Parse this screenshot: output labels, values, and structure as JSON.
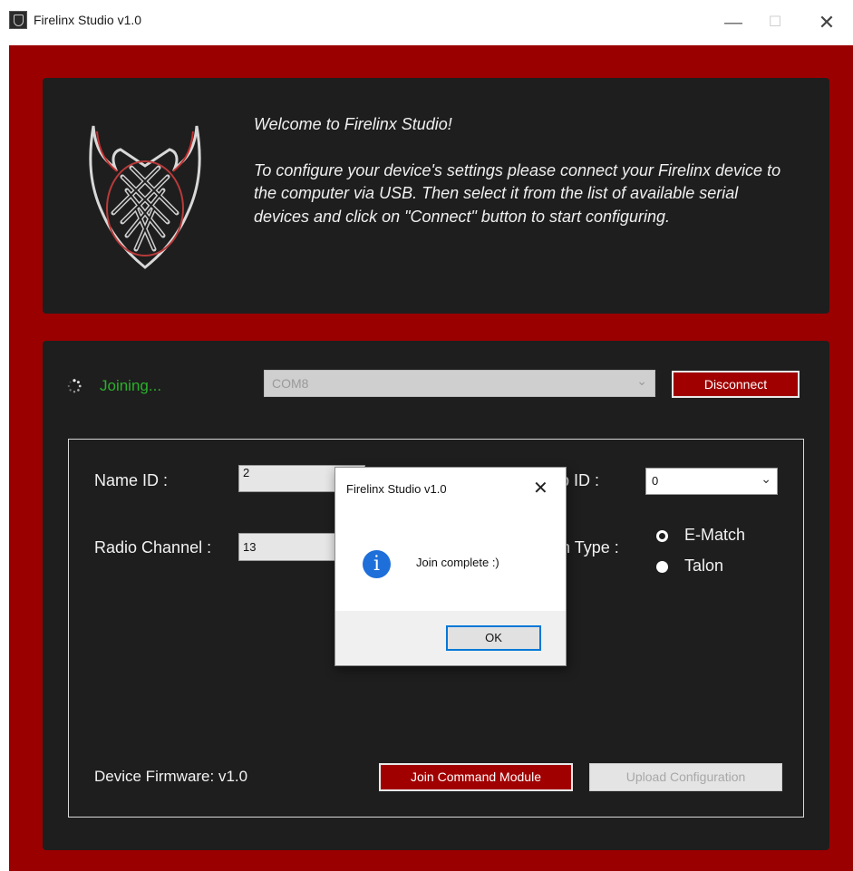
{
  "window": {
    "title": "Firelinx Studio  v1.0",
    "minimize_glyph": "—",
    "maximize_glyph": "☐",
    "close_glyph": "✕"
  },
  "welcome": {
    "heading": "Welcome to Firelinx Studio!",
    "body": "To configure your device's settings please connect your Firelinx device to the computer via USB. Then select it from the list of available serial devices and click on \"Connect\" button to start configuring."
  },
  "connection": {
    "status_text": "Joining...",
    "port_value": "COM8",
    "disconnect_label": "Disconnect"
  },
  "config": {
    "name_id_label": "Name ID :",
    "name_id_value": "2",
    "radio_channel_label": "Radio Channel :",
    "radio_channel_value": "13",
    "group_id_label": "Group ID :",
    "group_id_value": "0",
    "match_type_label": "Match Type :",
    "match_options": [
      {
        "label": "E-Match",
        "selected": false
      },
      {
        "label": "Talon",
        "selected": true
      }
    ],
    "firmware_text": "Device Firmware: v1.0",
    "join_label": "Join Command Module",
    "upload_label": "Upload Configuration"
  },
  "dialog": {
    "title": "Firelinx Studio  v1.0",
    "close_glyph": "✕",
    "icon_glyph": "i",
    "message": "Join complete :)",
    "ok_label": "OK"
  },
  "colors": {
    "frame": "#9a0000",
    "panel": "#1e1e1e",
    "status_green": "#2bb02b",
    "button_red": "#a00000",
    "info_blue": "#1e6fd9",
    "focus_blue": "#0078d7"
  },
  "icons": {
    "app": "firelinx-logo-icon",
    "spinner": "loading-spinner-icon",
    "info": "info-icon",
    "chevron": "chevron-down-icon"
  }
}
